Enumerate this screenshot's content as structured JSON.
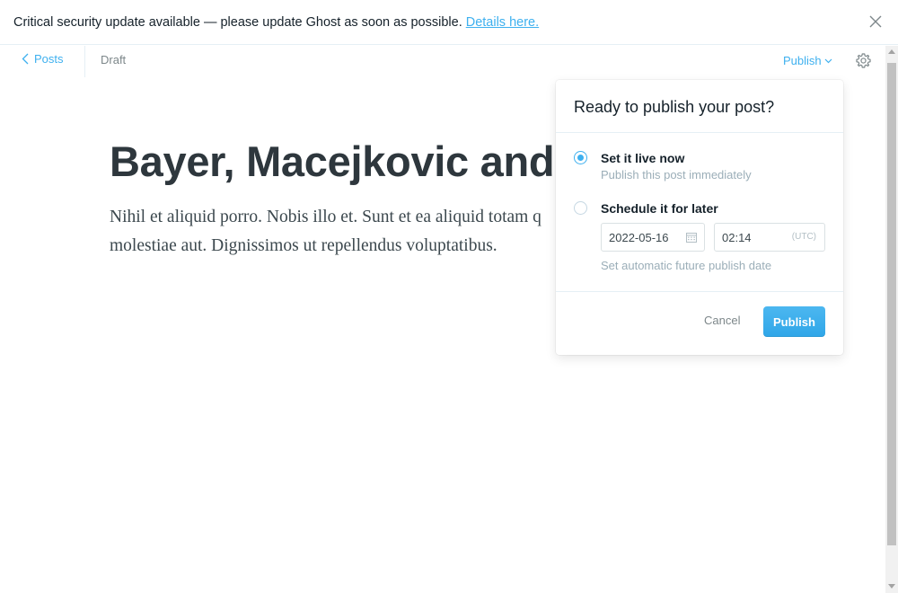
{
  "banner": {
    "message": "Critical security update available — please update Ghost as soon as possible.",
    "link_text": "Details here."
  },
  "header": {
    "back_label": "Posts",
    "status": "Draft",
    "publish_menu_label": "Publish"
  },
  "post": {
    "title": "Bayer, Macejkovic and C",
    "body": "Nihil et aliquid porro. Nobis illo et. Sunt et ea aliquid totam q molestiae aut. Dignissimos ut repellendus voluptatibus."
  },
  "publish_popover": {
    "title": "Ready to publish your post?",
    "option_now": {
      "label": "Set it live now",
      "description": "Publish this post immediately",
      "selected": true
    },
    "option_later": {
      "label": "Schedule it for later",
      "date_value": "2022-05-16",
      "time_value": "02:14",
      "timezone": "(UTC)",
      "hint": "Set automatic future publish date",
      "selected": false
    },
    "cancel_label": "Cancel",
    "publish_label": "Publish"
  },
  "colors": {
    "accent": "#3eb0ef",
    "text": "#15212a",
    "muted": "#9baeb8"
  },
  "icons": {
    "banner_close": "close-icon",
    "back": "chevron-left-icon",
    "publish_menu": "chevron-down-icon",
    "settings": "gear-icon",
    "date": "calendar-icon"
  }
}
